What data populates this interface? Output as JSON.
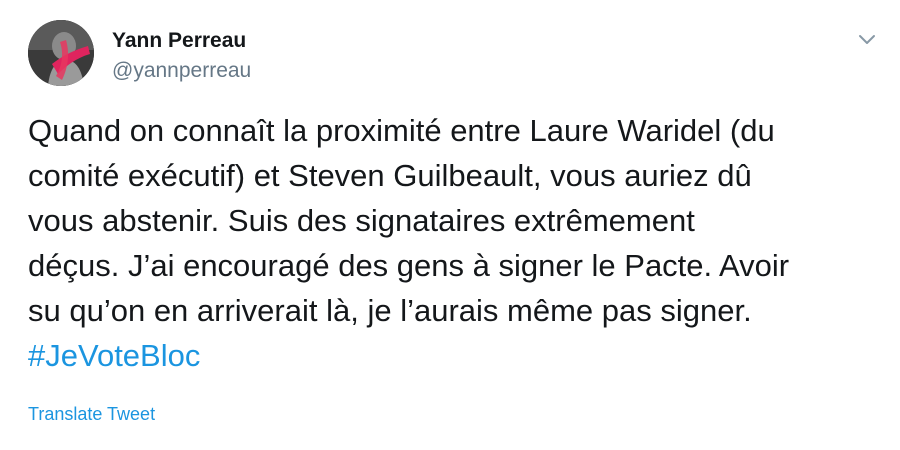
{
  "tweet": {
    "author": {
      "display_name": "Yann Perreau",
      "handle": "@yannperreau",
      "avatar_icon": "profile-photo"
    },
    "menu_icon": "chevron-down-icon",
    "text_lines": [
      "Quand on connaît la proximité entre Laure Waridel (du",
      "comité exécutif) et Steven Guilbeault, vous auriez dû",
      "vous abstenir. Suis des signataires extrêmement",
      "déçus. J’ai encouragé des gens à signer le Pacte. Avoir",
      "su qu’on en arriverait là, je l’aurais même pas signer."
    ],
    "hashtag": "#JeVoteBloc",
    "translate_label": "Translate Tweet"
  },
  "colors": {
    "text": "#14171a",
    "muted": "#657786",
    "link": "#1b95e0"
  }
}
